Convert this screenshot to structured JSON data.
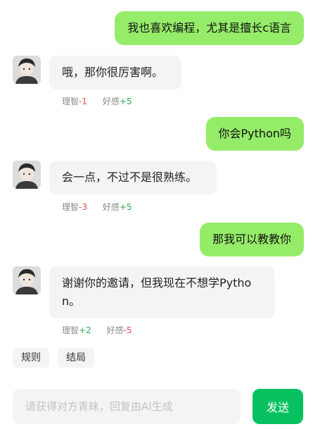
{
  "messages": [
    {
      "role": "user",
      "text": "我也喜欢编程，尤其是擅长c语言"
    },
    {
      "role": "bot",
      "text": "哦，那你很厉害啊。",
      "stats": {
        "label1": "理智",
        "value1": "-1",
        "label2": "好感",
        "value2": "+5"
      }
    },
    {
      "role": "user",
      "text": "你会Python吗"
    },
    {
      "role": "bot",
      "text": "会一点，不过不是很熟练。",
      "stats": {
        "label1": "理智",
        "value1": "-3",
        "label2": "好感",
        "value2": "+5"
      }
    },
    {
      "role": "user",
      "text": "那我可以教教你"
    },
    {
      "role": "bot",
      "text": "谢谢你的邀请，但我现在不想学Python。",
      "stats": {
        "label1": "理智",
        "value1": "+2",
        "label2": "好感",
        "value2": "-5"
      }
    }
  ],
  "actions": {
    "rules": "规则",
    "ending": "结局"
  },
  "composer": {
    "placeholder": "请获得对方青睐，回复由AI生成",
    "send_label": "发送"
  },
  "colors": {
    "user_bubble": "#95ec69",
    "send_button": "#07c160",
    "negative": "#e05050",
    "positive": "#2eaa55"
  }
}
